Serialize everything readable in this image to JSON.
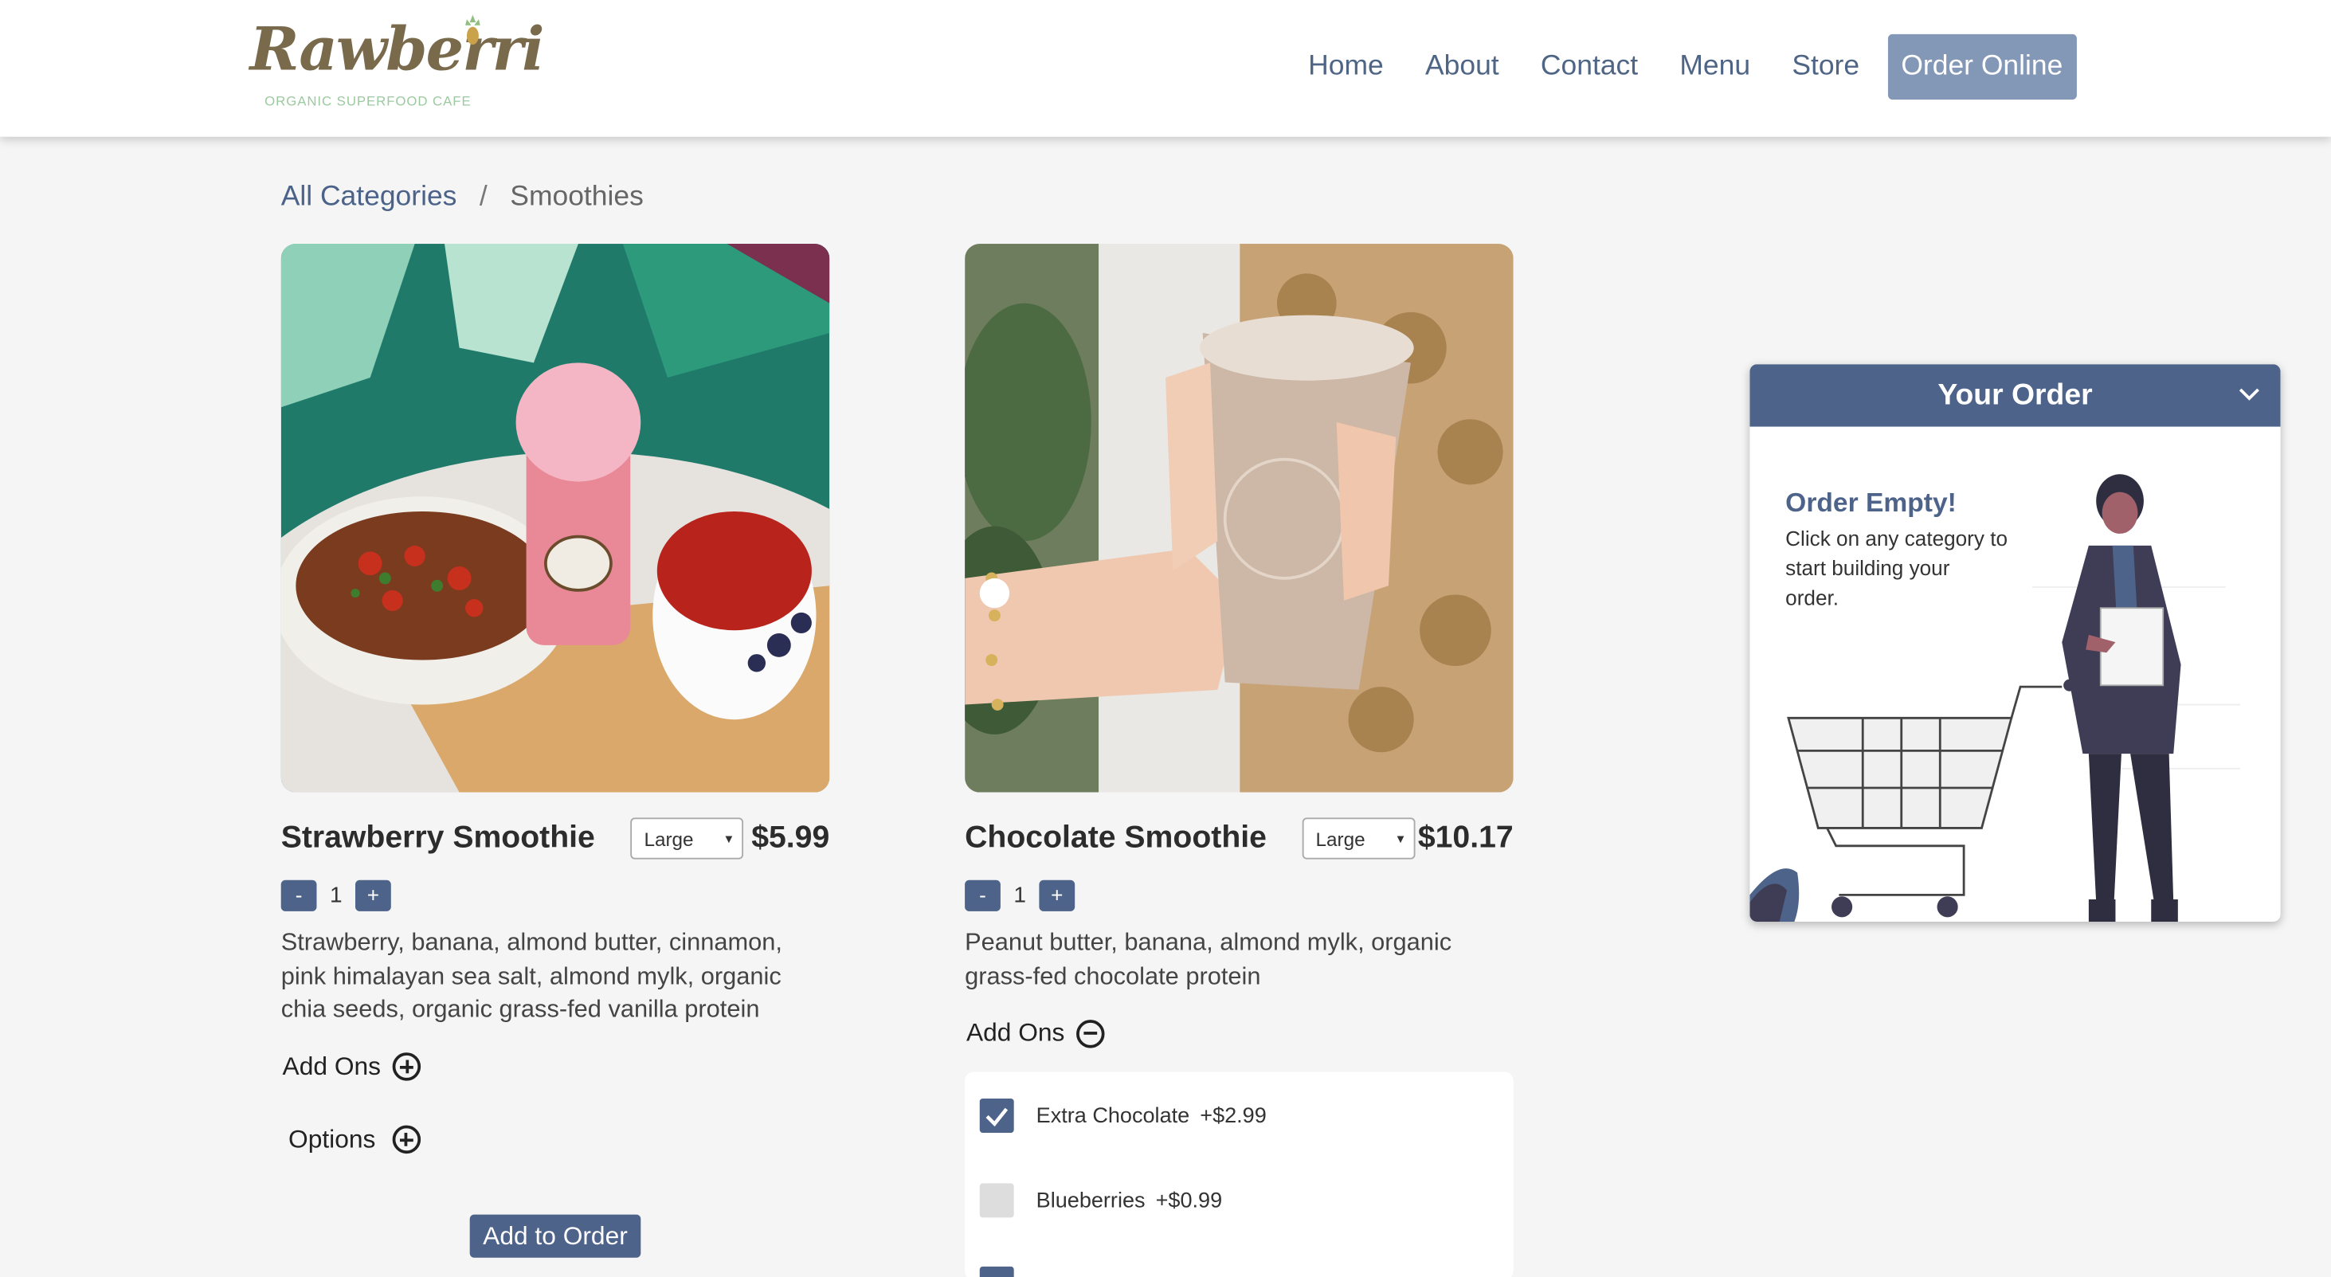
{
  "header": {
    "logo_text": "Rawberri",
    "logo_tagline": "ORGANIC SUPERFOOD CAFE",
    "nav": [
      "Home",
      "About",
      "Contact",
      "Menu",
      "Store"
    ],
    "order_online": "Order Online"
  },
  "breadcrumb": {
    "root": "All Categories",
    "separator": "/",
    "current": "Smoothies"
  },
  "products": [
    {
      "name": "Strawberry Smoothie",
      "size": "Large",
      "price": "$5.99",
      "qty_minus": "-",
      "qty": "1",
      "qty_plus": "+",
      "description": "Strawberry, banana, almond butter, cinnamon, pink himalayan sea salt, almond mylk, organic chia seeds, organic grass-fed vanilla protein",
      "addons_label": "Add Ons",
      "options_label": "Options",
      "add_button": "Add to Order"
    },
    {
      "name": "Chocolate Smoothie",
      "size": "Large",
      "price": "$10.17",
      "qty_minus": "-",
      "qty": "1",
      "qty_plus": "+",
      "description": "Peanut butter, banana, almond mylk, organic grass-fed chocolate protein",
      "addons_label": "Add Ons",
      "addons": [
        {
          "label": "Extra Chocolate",
          "price": "+$2.99",
          "checked": true
        },
        {
          "label": "Blueberries",
          "price": "+$0.99",
          "checked": false
        }
      ]
    }
  ],
  "order_widget": {
    "title": "Your Order",
    "empty_title": "Order Empty!",
    "empty_text": "Click on any category to start building your order."
  },
  "colors": {
    "accent": "#4d6389",
    "order_online_bg": "#8397b7",
    "nav_text": "#4f6585"
  }
}
